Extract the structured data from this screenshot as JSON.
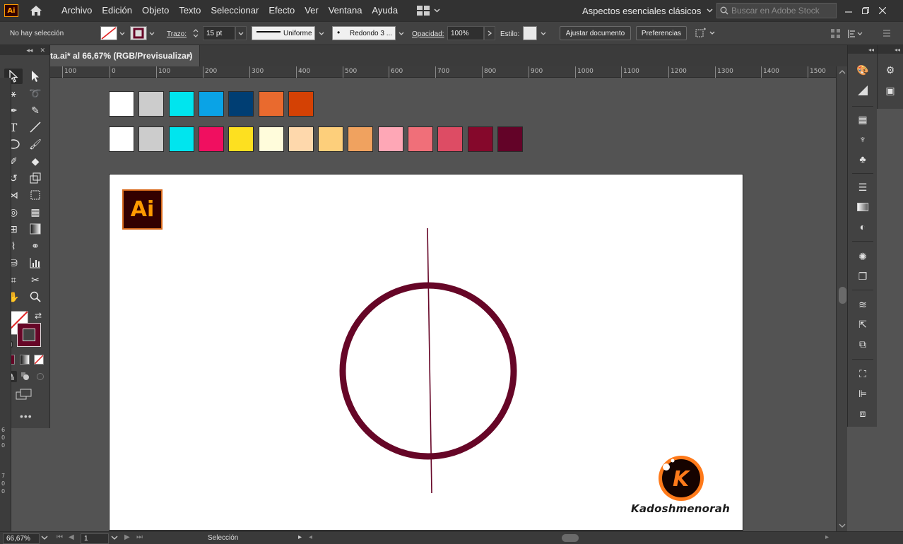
{
  "app": {
    "logo": "Ai"
  },
  "menu": [
    "Archivo",
    "Edición",
    "Objeto",
    "Texto",
    "Seleccionar",
    "Efecto",
    "Ver",
    "Ventana",
    "Ayuda"
  ],
  "workspace": {
    "label": "Aspectos esenciales clásicos"
  },
  "search": {
    "placeholder": "Buscar en Adobe Stock"
  },
  "control": {
    "selection": "No hay selección",
    "stroke_label": "Trazo:",
    "stroke_value": "15 pt",
    "profile": "Uniforme",
    "brush": "Redondo 3 ...",
    "opacity_label": "Opacidad:",
    "opacity_value": "100%",
    "style_label": "Estilo:",
    "fit_button": "Ajustar documento",
    "prefs_button": "Preferencias"
  },
  "document": {
    "tab_title": "ta.ai* al 66,67% (RGB/Previsualizar)",
    "close": "×"
  },
  "ruler": {
    "h_labels": [
      "100",
      "0",
      "100",
      "200",
      "300",
      "400",
      "500",
      "600",
      "700",
      "800",
      "900",
      "1000",
      "1100",
      "1200",
      "1300",
      "1400",
      "1500"
    ],
    "v_labels": [
      "6",
      "0",
      "0",
      "7",
      "0",
      "0"
    ]
  },
  "palette": {
    "row1": [
      "#ffffff",
      "#cccccc",
      "#00e5ee",
      "#0aa3e6",
      "#003e73",
      "#e96a2e",
      "#d44104"
    ],
    "row2": [
      "#ffffff",
      "#cccccc",
      "#00e5ee",
      "#f00f60",
      "#fde020",
      "#fffcdb",
      "#fed8ac",
      "#fdcf7b",
      "#f0a25f",
      "#fea7b6",
      "#f06f79",
      "#dd4c64",
      "#85082b",
      "#630328"
    ]
  },
  "artboard": {
    "badge": "Ai",
    "brand_letter": "K",
    "brand_name": "Kadoshmenorah",
    "stroke_color": "#660627"
  },
  "status": {
    "zoom": "66,67%",
    "artboard_number": "1",
    "tool": "Selección"
  }
}
